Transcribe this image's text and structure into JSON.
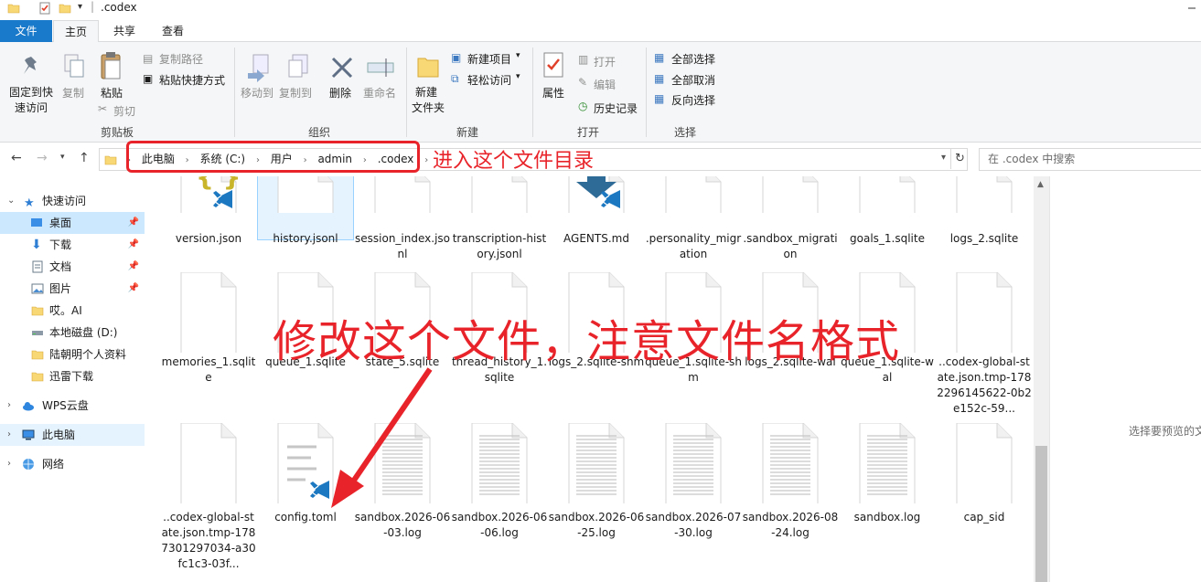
{
  "window": {
    "title": ".codex"
  },
  "tabs": [
    "文件",
    "主页",
    "共享",
    "查看"
  ],
  "ribbon": {
    "clipboard": {
      "pin": "固定到快速访问",
      "pin_line1": "固定到快",
      "pin_line2": "速访问",
      "copy": "复制",
      "paste": "粘贴",
      "copy_path": "复制路径",
      "paste_shortcut": "粘贴快捷方式",
      "cut": "剪切",
      "group": "剪贴板"
    },
    "organize": {
      "move_to": "移动到",
      "copy_to": "复制到",
      "delete": "删除",
      "rename": "重命名",
      "group": "组织"
    },
    "new": {
      "new_folder_line1": "新建",
      "new_folder_line2": "文件夹",
      "new_item": "新建项目",
      "easy_access": "轻松访问",
      "group": "新建"
    },
    "open": {
      "properties": "属性",
      "open": "打开",
      "edit": "编辑",
      "history": "历史记录",
      "group": "打开"
    },
    "select": {
      "select_all": "全部选择",
      "select_none": "全部取消",
      "invert": "反向选择",
      "group": "选择"
    }
  },
  "address": {
    "crumbs": [
      "此电脑",
      "系统 (C:)",
      "用户",
      "admin",
      ".codex"
    ],
    "search_placeholder": "在 .codex 中搜索"
  },
  "annotations": {
    "address_note": "进入这个文件目录",
    "file_note": "修改这个文件，注意文件名格式"
  },
  "nav": {
    "quick_access": "快速访问",
    "items": [
      {
        "label": "桌面",
        "pinned": true
      },
      {
        "label": "下载",
        "pinned": true
      },
      {
        "label": "文档",
        "pinned": true
      },
      {
        "label": "图片",
        "pinned": true
      },
      {
        "label": "哎。AI",
        "pinned": false
      },
      {
        "label": "本地磁盘 (D:)",
        "pinned": false
      },
      {
        "label": "陆朝明个人资料",
        "pinned": false
      },
      {
        "label": "迅雷下载",
        "pinned": false
      }
    ],
    "wps": "WPS云盘",
    "this_pc": "此电脑",
    "network": "网络"
  },
  "files": {
    "row1": [
      {
        "name": "version.json",
        "kind": "json"
      },
      {
        "name": "history.jsonl",
        "kind": "blank"
      },
      {
        "name": "session_index.jsonl",
        "kind": "blank"
      },
      {
        "name": "transcription-history.jsonl",
        "kind": "blank"
      },
      {
        "name": "AGENTS.md",
        "kind": "md"
      },
      {
        "name": ".personality_migration",
        "kind": "blank"
      },
      {
        "name": ".sandbox_migration",
        "kind": "blank"
      },
      {
        "name": "goals_1.sqlite",
        "kind": "blank"
      },
      {
        "name": "logs_2.sqlite",
        "kind": "blank"
      }
    ],
    "row2": [
      {
        "name": "memories_1.sqlite",
        "kind": "blank"
      },
      {
        "name": "queue_1.sqlite",
        "kind": "blank"
      },
      {
        "name": "state_5.sqlite",
        "kind": "blank"
      },
      {
        "name": "thread_history_1.sqlite",
        "kind": "blank"
      },
      {
        "name": "logs_2.sqlite-shm",
        "kind": "blank"
      },
      {
        "name": "queue_1.sqlite-shm",
        "kind": "blank"
      },
      {
        "name": "logs_2.sqlite-wal",
        "kind": "blank"
      },
      {
        "name": "queue_1.sqlite-wal",
        "kind": "blank"
      },
      {
        "name": "..codex-global-state.json.tmp-1782296145622-0b2e152c-59...",
        "kind": "blank"
      }
    ],
    "row3": [
      {
        "name": "..codex-global-state.json.tmp-1787301297034-a30fc1c3-03f...",
        "kind": "blank"
      },
      {
        "name": "config.toml",
        "kind": "toml"
      },
      {
        "name": "sandbox.2026-06-03.log",
        "kind": "log"
      },
      {
        "name": "sandbox.2026-06-06.log",
        "kind": "log"
      },
      {
        "name": "sandbox.2026-06-25.log",
        "kind": "log"
      },
      {
        "name": "sandbox.2026-07-30.log",
        "kind": "log"
      },
      {
        "name": "sandbox.2026-08-24.log",
        "kind": "log"
      },
      {
        "name": "sandbox.log",
        "kind": "log"
      },
      {
        "name": "cap_sid",
        "kind": "blank"
      }
    ]
  },
  "preview": {
    "text": "选择要预览的文"
  },
  "colors": {
    "accent": "#1979ca",
    "annotation": "#e8242a",
    "selected": "#cce8ff",
    "vscode": "#1c78c0"
  }
}
